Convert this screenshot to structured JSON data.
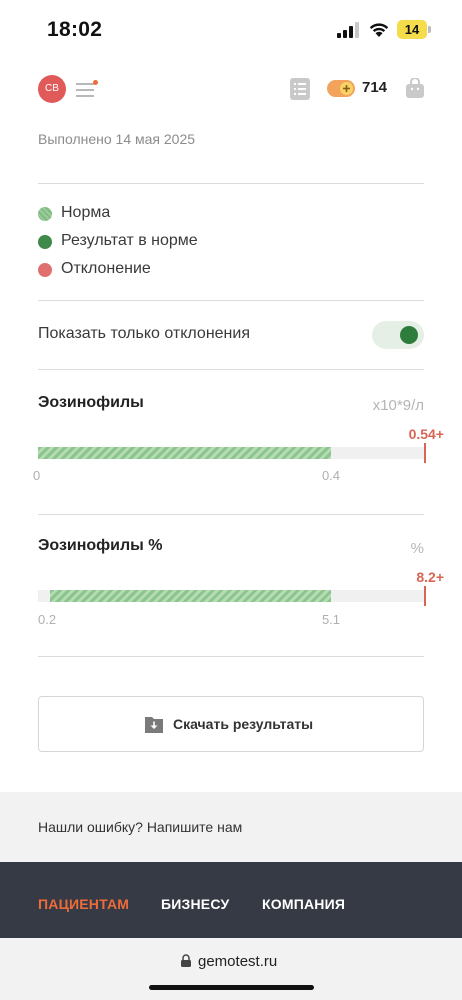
{
  "status_bar": {
    "time": "18:02",
    "battery": "14"
  },
  "topbar": {
    "avatar_initials": "СВ",
    "coins": "714"
  },
  "results": {
    "done_date": "Выполнено 14 мая 2025",
    "legend": [
      {
        "label": "Норма",
        "color": "#8cc48d"
      },
      {
        "label": "Результат в норме",
        "color": "#3f8a4a"
      },
      {
        "label": "Отклонение",
        "color": "#e07070"
      }
    ],
    "toggle_label": "Показать только отклонения",
    "toggle_on": true,
    "tests": [
      {
        "title": "Эозинофилы",
        "unit": "x10*9/л",
        "value": "0.54+",
        "norm_min": "0",
        "norm_max": "0.4",
        "norm_start_fraction": 0.0,
        "norm_end_fraction": 0.755,
        "value_fraction": 1.0
      },
      {
        "title": "Эозинофилы %",
        "unit": "%",
        "value": "8.2+",
        "norm_min": "0.2",
        "norm_max": "5.1",
        "norm_start_fraction": 0.03,
        "norm_end_fraction": 0.755,
        "value_fraction": 1.0
      }
    ],
    "download_label": "Скачать результаты"
  },
  "feedback": {
    "text": "Нашли ошибку? Напишите нам"
  },
  "footer": {
    "links": [
      "ПАЦИЕНТАМ",
      "БИЗНЕСУ",
      "КОМПАНИЯ"
    ],
    "active_color": "#ee6b3a"
  },
  "browser": {
    "url": "gemotest.ru"
  }
}
